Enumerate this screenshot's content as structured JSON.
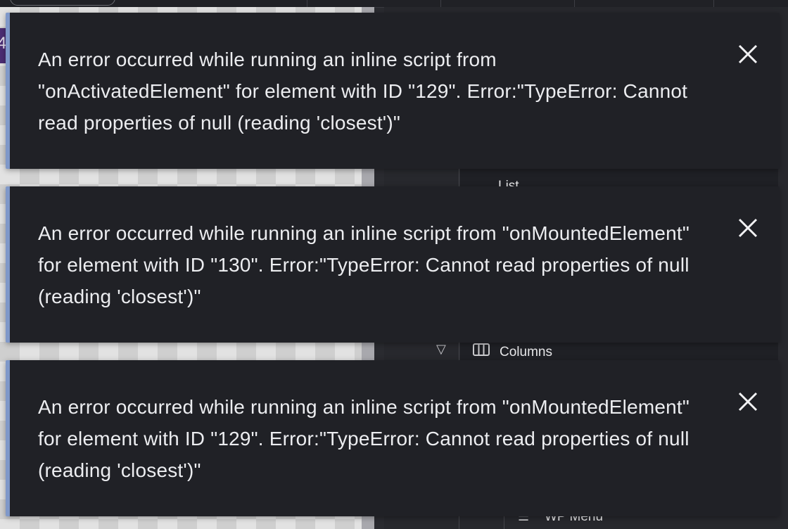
{
  "background": {
    "tree_items": [
      {
        "label": "List"
      },
      {
        "label": "Columns",
        "icon": "columns-icon"
      },
      {
        "label": "WP Menu",
        "icon": "menu-icon"
      }
    ],
    "canvas_fragment": "4"
  },
  "toasts": [
    {
      "message": "An error occurred while running an inline script from \"onActivatedElement\" for element with ID \"129\". Error:\"TypeError: Cannot read properties of null (reading 'closest')\"",
      "close_icon": "close-icon"
    },
    {
      "message": "An error occurred while running an inline script from \"onMountedElement\" for element with ID \"130\". Error:\"TypeError: Cannot read properties of null (reading 'closest')\"",
      "close_icon": "close-icon"
    },
    {
      "message": "An error occurred while running an inline script from \"onMountedElement\" for element with ID \"129\". Error:\"TypeError: Cannot read properties of null (reading 'closest')\"",
      "close_icon": "close-icon"
    }
  ],
  "colors": {
    "toast_bg": "#202126",
    "toast_accent": "#7f98c9",
    "text": "#ecedf0"
  }
}
